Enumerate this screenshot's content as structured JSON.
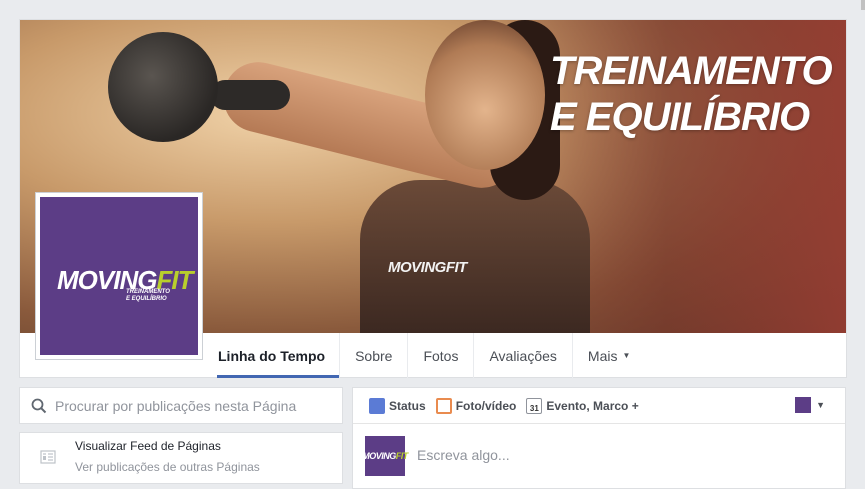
{
  "cover": {
    "headline_line1": "TREINAMENTO",
    "headline_line2": "E EQUILÍBRIO",
    "shirt_logo": "MOVINGFIT"
  },
  "profile": {
    "logo_moving": "MOVING",
    "logo_fit": "FIT",
    "tagline_line1": "TREINAMENTO",
    "tagline_line2": "E EQUILÍBRIO",
    "accent": "#b9cf2c",
    "brand": "#5c3d86"
  },
  "tabs": [
    {
      "label": "Linha do Tempo",
      "active": true
    },
    {
      "label": "Sobre"
    },
    {
      "label": "Fotos"
    },
    {
      "label": "Avaliações"
    },
    {
      "label": "Mais",
      "icon": "caret-down-icon"
    }
  ],
  "search": {
    "placeholder": "Procurar por publicações nesta Página"
  },
  "feed": {
    "title": "Visualizar Feed de Páginas",
    "subtitle": "Ver publicações de outras Páginas"
  },
  "composer": {
    "status_label": "Status",
    "photo_label": "Foto/vídeo",
    "event_label": "Evento, Marco +",
    "event_day": "31",
    "avatar_moving": "MOVING",
    "avatar_fit": "FIT",
    "input_placeholder": "Escreva algo..."
  }
}
